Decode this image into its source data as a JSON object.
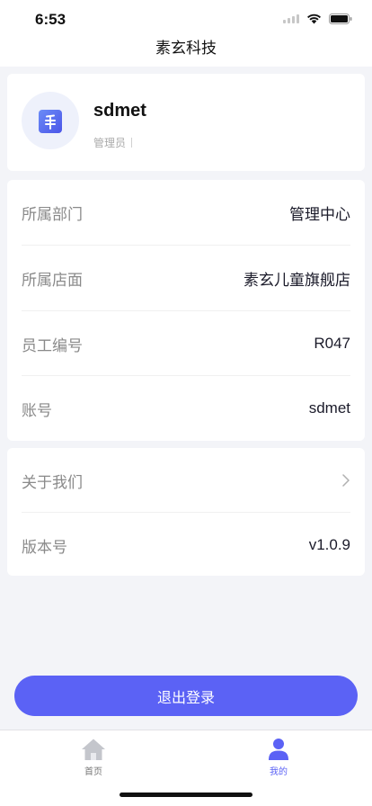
{
  "status_bar": {
    "time": "6:53"
  },
  "nav": {
    "title": "素玄科技"
  },
  "profile": {
    "username": "sdmet",
    "role": "管理员"
  },
  "info": {
    "rows": [
      {
        "label": "所属部门",
        "value": "管理中心"
      },
      {
        "label": "所属店面",
        "value": "素玄儿童旗舰店"
      },
      {
        "label": "员工编号",
        "value": "R047"
      },
      {
        "label": "账号",
        "value": "sdmet"
      }
    ]
  },
  "about": {
    "about_label": "关于我们",
    "version_label": "版本号",
    "version_value": "v1.0.9"
  },
  "logout": {
    "label": "退出登录"
  },
  "tabs": [
    {
      "label": "首页",
      "icon": "home-icon"
    },
    {
      "label": "我的",
      "icon": "user-icon"
    }
  ],
  "colors": {
    "accent": "#5b62f5",
    "background": "#f3f4f8"
  }
}
